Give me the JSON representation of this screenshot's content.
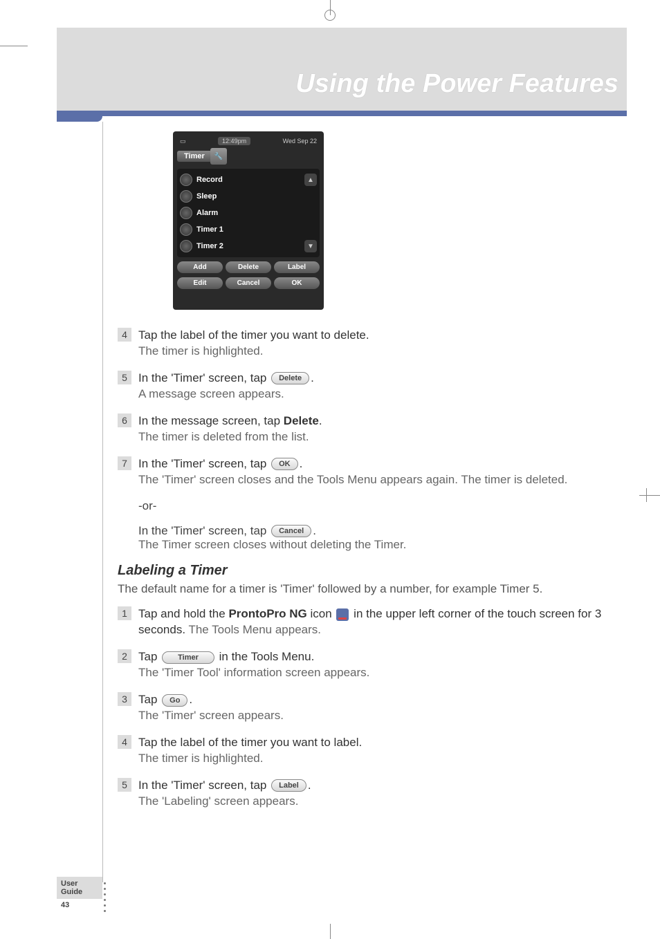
{
  "chapter_title": "Using the Power Features",
  "device": {
    "time": "12:49pm",
    "date": "Wed Sep 22",
    "tab": "Timer",
    "items": [
      "Record",
      "Sleep",
      "Alarm",
      "Timer 1",
      "Timer 2"
    ],
    "row1": [
      "Add",
      "Delete",
      "Label"
    ],
    "row2": [
      "Edit",
      "Cancel",
      "OK"
    ]
  },
  "section_a": {
    "s4": {
      "n": "4",
      "line1": "Tap the label of the timer you want to delete.",
      "sub": "The timer is highlighted."
    },
    "s5": {
      "n": "5",
      "pre": "In the 'Timer' screen, tap ",
      "pill": "Delete",
      "post": ".",
      "sub": "A message screen appears."
    },
    "s6": {
      "n": "6",
      "pre": "In the message screen, tap ",
      "bold": "Delete",
      "post": ".",
      "sub": "The timer is deleted from the list."
    },
    "s7": {
      "n": "7",
      "pre": "In the 'Timer' screen, tap ",
      "pill": "OK",
      "post": ".",
      "sub": "The 'Timer' screen closes and the Tools Menu appears again. The timer is deleted."
    },
    "or": "-or-",
    "alt_pre": "In the 'Timer' screen, tap ",
    "alt_pill": "Cancel",
    "alt_post": ".",
    "alt_sub": "The Timer screen closes without deleting the Timer."
  },
  "section_b": {
    "heading": "Labeling a Timer",
    "intro": "The default name for a timer is 'Timer' followed by a number, for example Timer 5.",
    "s1": {
      "n": "1",
      "pre": "Tap and hold the ",
      "bold": "ProntoPro NG",
      "mid": " icon ",
      "post": " in the upper left corner of the touch screen for 3 seconds.",
      "sub": " The Tools Menu appears."
    },
    "s2": {
      "n": "2",
      "pre": "Tap ",
      "pill": "Timer",
      "post": " in the Tools Menu.",
      "sub": "The 'Timer Tool' information screen appears."
    },
    "s3": {
      "n": "3",
      "pre": "Tap ",
      "pill": "Go",
      "post": ".",
      "sub": "The 'Timer' screen appears."
    },
    "s4": {
      "n": "4",
      "line1": "Tap the label of the timer you want to label.",
      "sub": "The timer is highlighted."
    },
    "s5": {
      "n": "5",
      "pre": "In the 'Timer' screen, tap ",
      "pill": "Label",
      "post": ".",
      "sub": "The 'Labeling' screen appears."
    }
  },
  "footer": {
    "guide": "User Guide",
    "page": "43"
  }
}
